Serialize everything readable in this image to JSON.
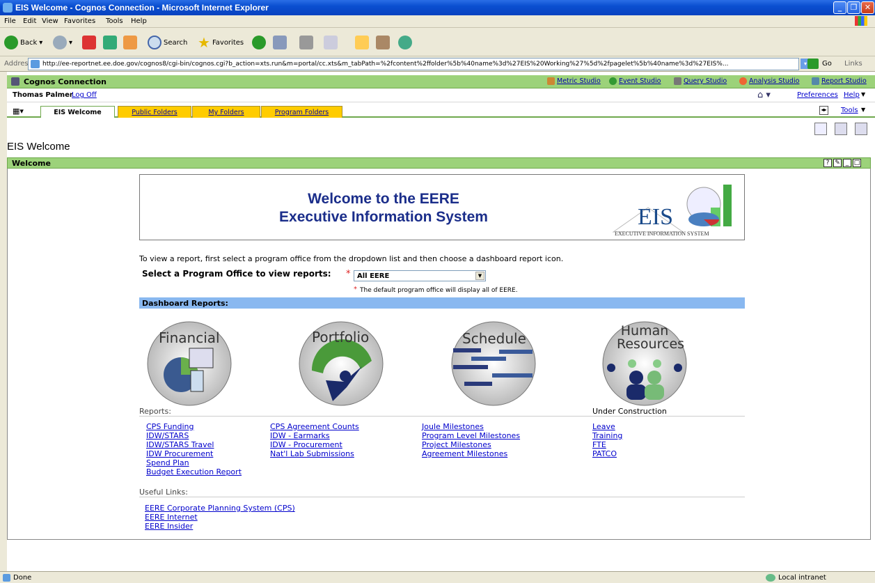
{
  "window": {
    "title": "EIS Welcome - Cognos Connection - Microsoft Internet Explorer"
  },
  "menu": [
    "File",
    "Edit",
    "View",
    "Favorites",
    "Tools",
    "Help"
  ],
  "toolbar": {
    "back": "Back",
    "search": "Search",
    "favorites": "Favorites"
  },
  "address": {
    "label": "Address",
    "url": "http://ee-reportnet.ee.doe.gov/cognos8/cgi-bin/cognos.cgi?b_action=xts.run&m=portal/cc.xts&m_tabPath=%2fcontent%2ffolder%5b%40name%3d%27EIS%20Working%27%5d%2fpagelet%5b%40name%3d%27EIS%...",
    "go": "Go",
    "links": "Links"
  },
  "cognos": {
    "title": "Cognos Connection",
    "studios": [
      "Metric Studio",
      "Event Studio",
      "Query Studio",
      "Analysis Studio",
      "Report Studio"
    ]
  },
  "user": {
    "name": "Thomas Palmer",
    "logoff": "Log Off",
    "preferences": "Preferences",
    "help": "Help",
    "tools": "Tools"
  },
  "tabs": [
    "EIS Welcome",
    "Public Folders",
    "My Folders",
    "Program Folders"
  ],
  "page": {
    "title": "EIS Welcome"
  },
  "portlet": {
    "title": "Welcome"
  },
  "banner": {
    "line1": "Welcome to the EERE",
    "line2": "Executive Information System",
    "logo": "EIS",
    "logo_sub": "Executive Information System"
  },
  "instructions": "To view a report, first select a program office from the dropdown list and then choose a dashboard report icon.",
  "select": {
    "label": "Select a Program Office to view reports:",
    "required": "*",
    "value": "All EERE",
    "note": "The default program office will display all of EERE."
  },
  "dashboard": {
    "title": "Dashboard Reports:",
    "icons": [
      "Financial",
      "Portfolio",
      "Schedule",
      "Human Resources"
    ]
  },
  "reports_label": "Reports:",
  "under_construction": "Under Construction",
  "reports": {
    "financial": [
      "CPS Funding",
      "IDW/STARS",
      "IDW/STARS Travel",
      "IDW Procurement",
      "Spend Plan",
      "Budget Execution Report"
    ],
    "portfolio": [
      "CPS Agreement Counts",
      "IDW - Earmarks",
      "IDW - Procurement",
      "Nat'l Lab Submissions"
    ],
    "schedule": [
      "Joule Milestones",
      "Program Level Milestones",
      "Project Milestones",
      "Agreement Milestones"
    ],
    "hr": [
      "Leave",
      "Training",
      "FTE",
      "PATCO"
    ]
  },
  "useful": {
    "label": "Useful Links:",
    "links": [
      "EERE Corporate Planning System (CPS)",
      "EERE Internet",
      "EERE Insider"
    ]
  },
  "status": {
    "left": "Done",
    "right": "Local intranet"
  }
}
